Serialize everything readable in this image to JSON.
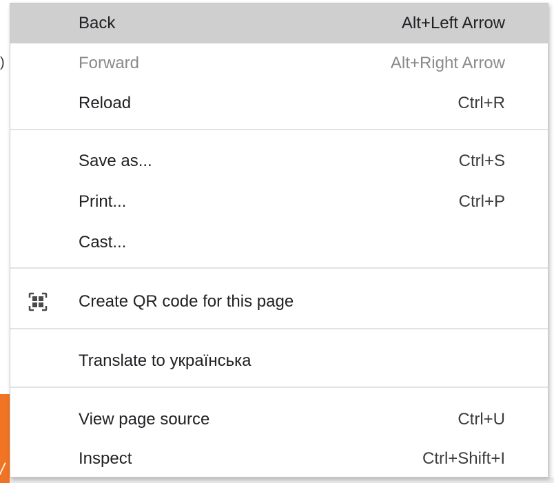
{
  "menu": {
    "back": {
      "label": "Back",
      "shortcut": "Alt+Left Arrow"
    },
    "forward": {
      "label": "Forward",
      "shortcut": "Alt+Right Arrow"
    },
    "reload": {
      "label": "Reload",
      "shortcut": "Ctrl+R"
    },
    "save_as": {
      "label": "Save as...",
      "shortcut": "Ctrl+S"
    },
    "print": {
      "label": "Print...",
      "shortcut": "Ctrl+P"
    },
    "cast": {
      "label": "Cast..."
    },
    "create_qr": {
      "label": "Create QR code for this page",
      "icon": "qr-code-icon"
    },
    "translate": {
      "label": "Translate to українська"
    },
    "view_source": {
      "label": "View page source",
      "shortcut": "Ctrl+U"
    },
    "inspect": {
      "label": "Inspect",
      "shortcut": "Ctrl+Shift+I"
    }
  },
  "colors": {
    "highlight": "#cfcfcf",
    "disabled_text": "#8a8a8a",
    "text": "#202124",
    "background_accent": "#f07423"
  }
}
